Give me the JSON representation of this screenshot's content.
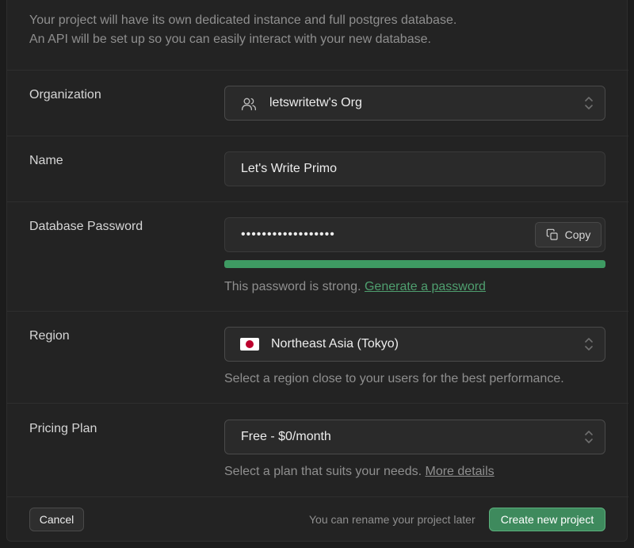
{
  "intro": {
    "line1": "Your project will have its own dedicated instance and full postgres database.",
    "line2": "An API will be set up so you can easily interact with your new database."
  },
  "organization": {
    "label": "Organization",
    "value": "letswritetw's Org",
    "icon": "users-icon"
  },
  "name": {
    "label": "Name",
    "value": "Let's Write Primo"
  },
  "password": {
    "label": "Database Password",
    "masked_value": "••••••••••••••••••",
    "copy_label": "Copy",
    "strength_fraction": 1.0,
    "hint": "This password is strong.",
    "generate_link": "Generate a password"
  },
  "region": {
    "label": "Region",
    "value": "Northeast Asia (Tokyo)",
    "flag": "japan-flag",
    "hint": "Select a region close to your users for the best performance."
  },
  "pricing": {
    "label": "Pricing Plan",
    "value": "Free - $0/month",
    "hint": "Select a plan that suits your needs.",
    "details_link": "More details"
  },
  "footer": {
    "cancel_label": "Cancel",
    "note": "You can rename your project later",
    "create_label": "Create new project"
  },
  "colors": {
    "accent_green": "#3e8a5d",
    "strength_green": "#3e9a62",
    "background": "#232323"
  }
}
